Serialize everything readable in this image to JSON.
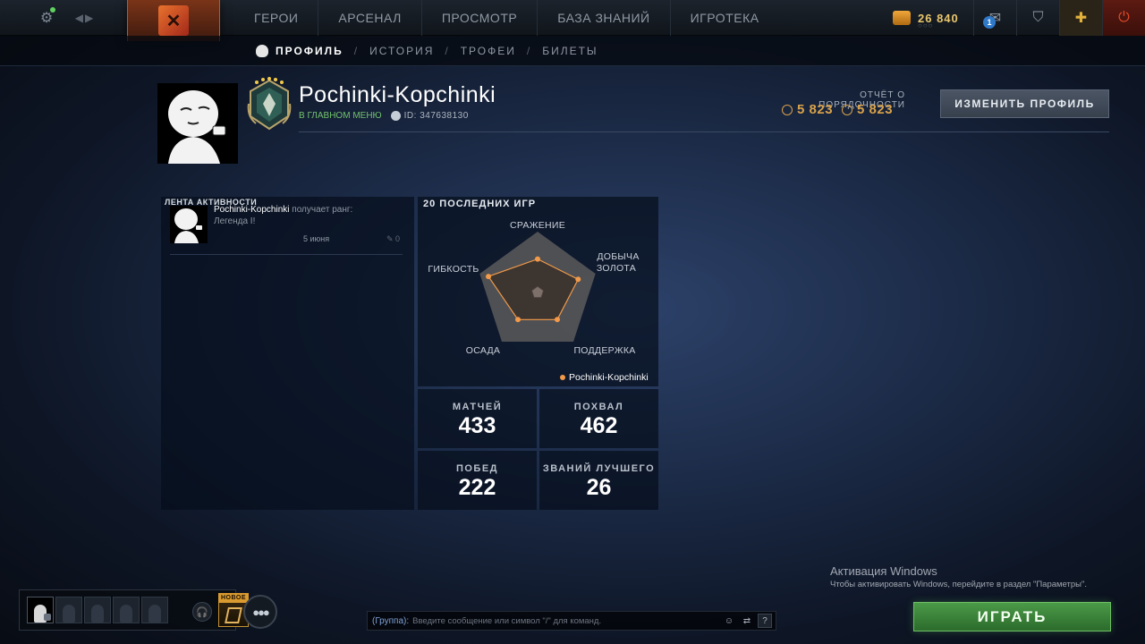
{
  "topbar": {
    "icons": {
      "settings": "gear-icon",
      "back": "chevron-left-icon",
      "forward": "chevron-right-icon",
      "logo": "dota-logo"
    },
    "nav": [
      "ГЕРОИ",
      "АРСЕНАЛ",
      "ПРОСМОТР",
      "БАЗА ЗНАНИЙ",
      "ИГРОТЕКА"
    ],
    "shards": "26 840",
    "notifications_count": "1"
  },
  "subnav": {
    "items": [
      "ПРОФИЛЬ",
      "ИСТОРИЯ",
      "ТРОФЕИ",
      "БИЛЕТЫ"
    ],
    "active": "ПРОФИЛЬ",
    "separator": "/"
  },
  "profile": {
    "name": "Pochinki-Kopchinki",
    "status": "В ГЛАВНОМ МЕНЮ",
    "steam_id": "ID: 347638130",
    "rank_medal": "legend-medal",
    "conduct_label": "ОТЧЁТ О ПОРЯДОЧНОСТИ",
    "conduct_value_1": "5 823",
    "conduct_value_2": "5 823",
    "edit_button": "ИЗМЕНИТЬ ПРОФИЛЬ"
  },
  "activity": {
    "title": "ЛЕНТА АКТИВНОСТИ",
    "items": [
      {
        "user": "Pochinki-Kopchinki",
        "verb": "получает ранг:",
        "rank": "Легенда I!",
        "date": "5 июня",
        "comments": "0"
      }
    ]
  },
  "games": {
    "title": "20 ПОСЛЕДНИХ ИГР",
    "legend": "Pochinki-Kopchinki",
    "radar_labels": {
      "fighting": "СРАЖЕНИЕ",
      "farming_1": "ДОБЫЧА",
      "farming_2": "ЗОЛОТА",
      "support": "ПОДДЕРЖКА",
      "pushing": "ОСАДА",
      "versatility": "ГИБКОСТЬ"
    },
    "radar_values": {
      "fighting": 0.55,
      "farming": 0.7,
      "support": 0.55,
      "pushing": 0.55,
      "versatility": 0.85
    },
    "colors": {
      "series": "#f29a4a",
      "outer": "#5b5b5b"
    }
  },
  "stats": {
    "matches": {
      "label": "МАТЧЕЙ",
      "value": "433"
    },
    "commends": {
      "label": "ПОХВАЛ",
      "value": "462"
    },
    "wins": {
      "label": "ПОБЕД",
      "value": "222"
    },
    "mvp": {
      "label": "ЗВАНИЙ ЛУЧШЕГО",
      "value": "26"
    }
  },
  "windows": {
    "title": "Активация Windows",
    "subtitle": "Чтобы активировать Windows, перейдите в раздел \"Параметры\"."
  },
  "bottom": {
    "new_badge": "НОВОЕ",
    "chat_channel": "(Группа):",
    "chat_placeholder": "Введите сообщение или символ \"/\" для команд.",
    "help": "?",
    "play": "ИГРАТЬ"
  }
}
